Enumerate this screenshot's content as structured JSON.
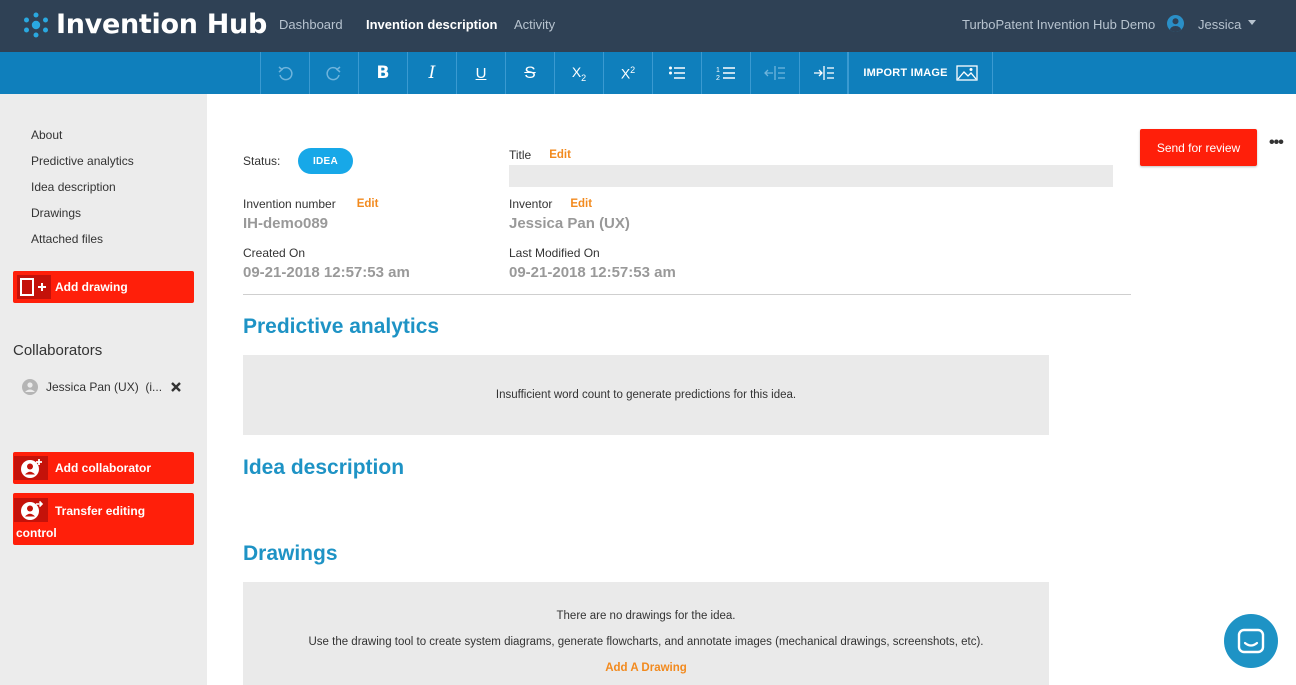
{
  "app": {
    "name": "Invention Hub"
  },
  "nav": [
    {
      "label": "Dashboard"
    },
    {
      "label": "Invention description"
    },
    {
      "label": "Activity"
    }
  ],
  "header": {
    "org": "TurboPatent Invention Hub Demo",
    "user": "Jessica"
  },
  "toolbar": {
    "import_label": "IMPORT IMAGE"
  },
  "sidebar": {
    "links": [
      "About",
      "Predictive analytics",
      "Idea description",
      "Drawings",
      "Attached files"
    ],
    "add_drawing": "Add drawing",
    "collaborators_title": "Collaborators",
    "collaborator": "Jessica Pan (UX)  (i...",
    "add_collaborator": "Add collaborator",
    "transfer_line1": "Transfer editing",
    "transfer_line2": "control"
  },
  "meta": {
    "status_label": "Status:",
    "status_value": "IDEA",
    "title_label": "Title",
    "edit": "Edit",
    "invention_number_label": "Invention number",
    "invention_number": "IH-demo089",
    "inventor_label": "Inventor",
    "inventor": "Jessica Pan (UX)",
    "created_label": "Created On",
    "created": "09-21-2018 12:57:53 am",
    "modified_label": "Last Modified On",
    "modified": "09-21-2018 12:57:53 am"
  },
  "actions": {
    "send_review": "Send for review",
    "more": "•••"
  },
  "sections": {
    "predictive_title": "Predictive analytics",
    "predictive_msg": "Insufficient word count to generate predictions for this idea.",
    "idea_title": "Idea description",
    "drawings_title": "Drawings",
    "drawings_msg1": "There are no drawings for the idea.",
    "drawings_msg2": "Use the drawing tool to create system diagrams, generate flowcharts, and annotate images (mechanical drawings, screenshots, etc).",
    "drawings_link": "Add A Drawing"
  },
  "colors": {
    "nav_bg": "#2f4155",
    "toolbar_bg": "#0f7fbc",
    "accent": "#1e93c5",
    "red": "#ff1f0a",
    "orange": "#f28a1e",
    "pill": "#17a8e8"
  }
}
